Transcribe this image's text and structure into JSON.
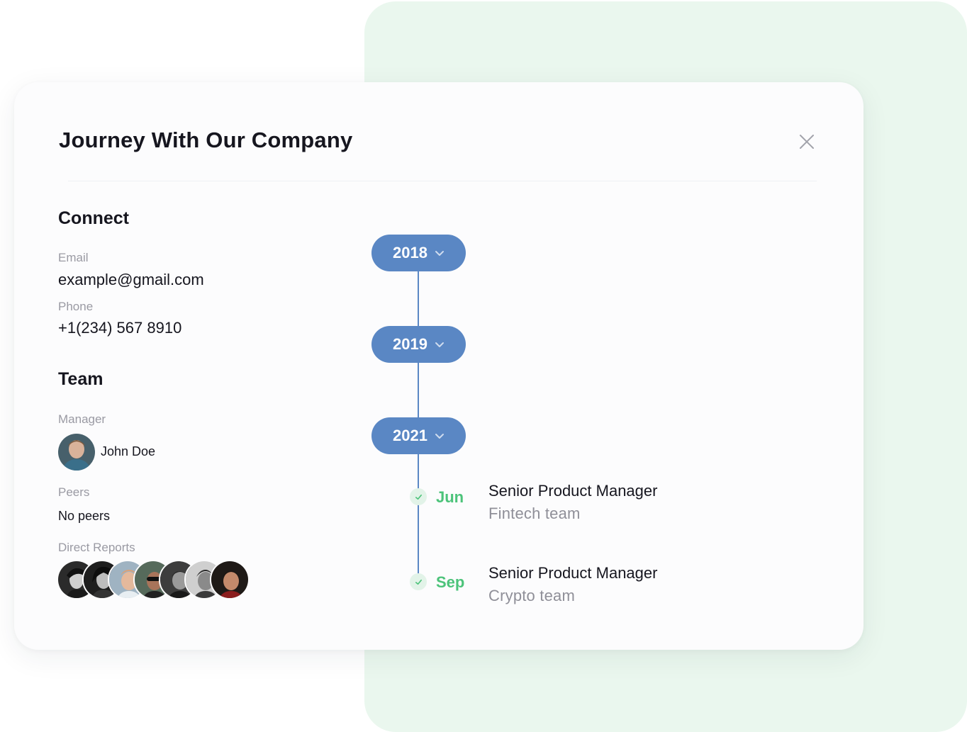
{
  "modal": {
    "title": "Journey With Our Company"
  },
  "connect": {
    "heading": "Connect",
    "email_label": "Email",
    "email_value": "example@gmail.com",
    "phone_label": "Phone",
    "phone_value": "+1(234) 567 8910"
  },
  "team": {
    "heading": "Team",
    "manager_label": "Manager",
    "manager_name": "John Doe",
    "peers_label": "Peers",
    "peers_value": "No peers",
    "reports_label": "Direct Reports",
    "reports_count": 7
  },
  "timeline": {
    "years": [
      {
        "label": "2018"
      },
      {
        "label": "2019"
      },
      {
        "label": "2021"
      }
    ],
    "events": [
      {
        "month": "Jun",
        "role": "Senior Product Manager",
        "team": "Fintech team"
      },
      {
        "month": "Sep",
        "role": "Senior Product Manager",
        "team": "Crypto team"
      }
    ]
  },
  "colors": {
    "accent_blue": "#5a87c4",
    "accent_green": "#4cc37a",
    "background_panel": "#eaf7ee"
  },
  "icons": {
    "close": "close-icon",
    "chevron": "chevron-down-icon",
    "check": "check-icon"
  }
}
